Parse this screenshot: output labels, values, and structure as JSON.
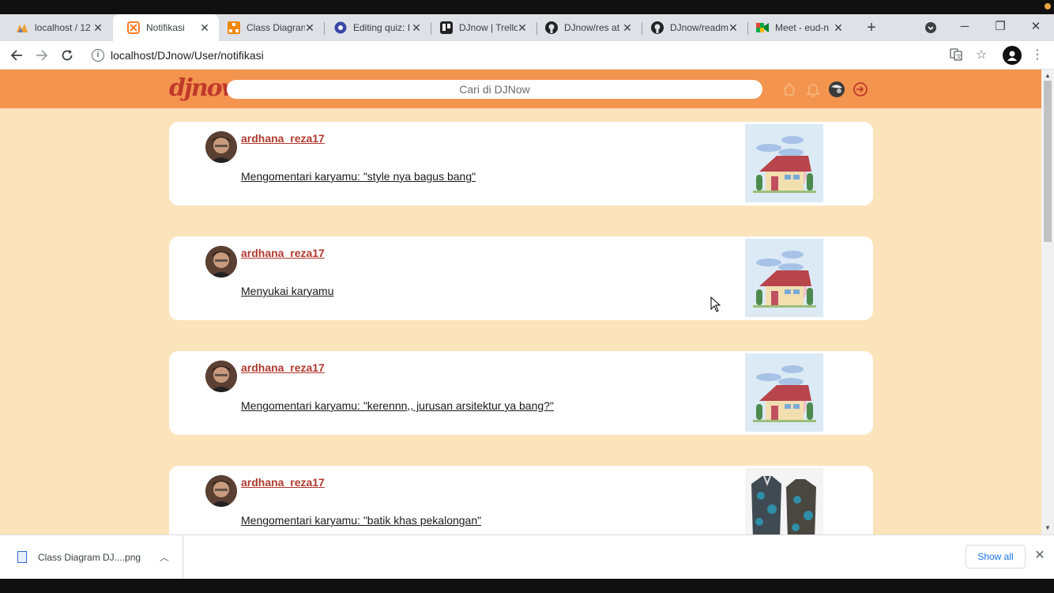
{
  "browser": {
    "tabs": [
      {
        "title": "localhost / 12",
        "icon": "phpmyadmin-icon"
      },
      {
        "title": "Notifikasi",
        "icon": "xampp-icon",
        "active": true
      },
      {
        "title": "Class Diagran",
        "icon": "drawio-icon"
      },
      {
        "title": "Editing quiz: I",
        "icon": "moodle-icon"
      },
      {
        "title": "DJnow | Trello",
        "icon": "trello-icon"
      },
      {
        "title": "DJnow/res at",
        "icon": "github-icon"
      },
      {
        "title": "DJnow/readm",
        "icon": "github-icon"
      },
      {
        "title": "Meet - eud-n",
        "icon": "google-meet-icon"
      }
    ],
    "new_tab_label": "+",
    "url": "localhost/DJnow/User/notifikasi"
  },
  "site": {
    "logo": "djnow",
    "search_placeholder": "Cari di DJNow",
    "accent_color": "#f3944f",
    "background_color": "#fbe3bb",
    "link_color": "#b03a2e"
  },
  "notifications": [
    {
      "username": "ardhana_reza17",
      "message": "Mengomentari karyamu: \"style nya bagus bang\"",
      "thumbnail": "house-illustration"
    },
    {
      "username": "ardhana_reza17",
      "message": "Menyukai karyamu",
      "thumbnail": "house-illustration"
    },
    {
      "username": "ardhana_reza17",
      "message": "Mengomentari karyamu: \"kerennn,, jurusan arsitektur ya bang?\"",
      "thumbnail": "house-illustration"
    },
    {
      "username": "ardhana_reza17",
      "message": "Mengomentari karyamu: \"batik khas pekalongan\"",
      "thumbnail": "batik-shirts-photo"
    }
  ],
  "download_shelf": {
    "file_name": "Class Diagram DJ....png",
    "show_all_label": "Show all"
  }
}
